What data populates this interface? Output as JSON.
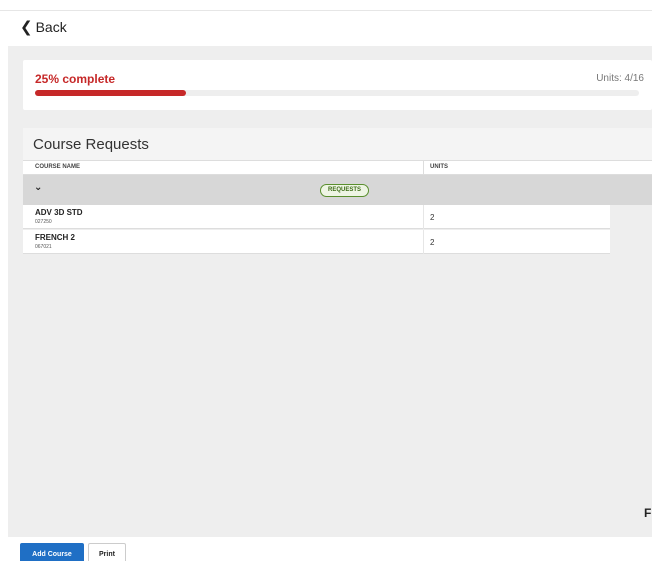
{
  "nav": {
    "back_label": "Back",
    "back_icon": "chevron-left-icon"
  },
  "progress": {
    "label": "25% complete",
    "units_text": "Units: 4/16",
    "fraction": 0.25,
    "color": "#c62828"
  },
  "course_requests": {
    "title": "Course Requests",
    "columns": [
      "COURSE NAME",
      "UNITS"
    ],
    "group_badge": "REQUESTS",
    "rows": [
      {
        "name": "ADV 3D STD",
        "code": "027250",
        "units": "2"
      },
      {
        "name": "FRENCH 2",
        "code": "067021",
        "units": "2"
      }
    ]
  },
  "edge_text": "F",
  "actions": {
    "add_course_label": "Add Course",
    "print_label": "Print"
  },
  "colors": {
    "primary": "#1f6fc5",
    "badge_green": "#5a8f2e"
  }
}
